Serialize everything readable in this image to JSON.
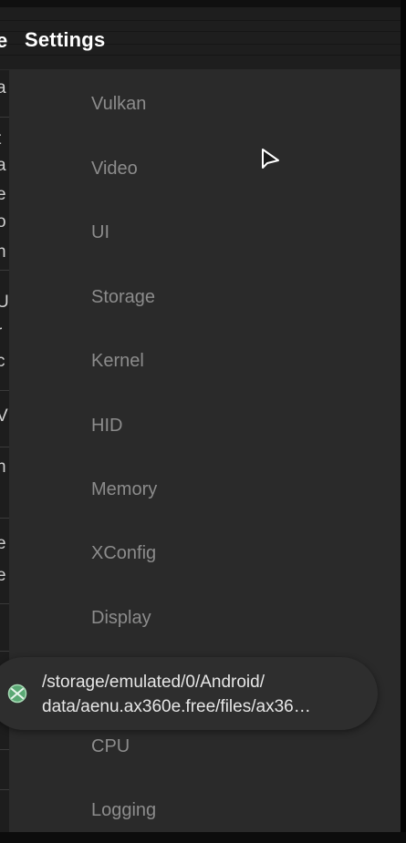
{
  "app_bar": {
    "title": "Settings",
    "edge_fragment": "e"
  },
  "background_page": {
    "edge_fragments": [
      "a",
      "t",
      "a",
      "e",
      "o",
      "n",
      "U",
      "r",
      "c",
      "V",
      "n",
      "e",
      "e"
    ]
  },
  "drawer": {
    "items": [
      {
        "label": "Vulkan"
      },
      {
        "label": "Video"
      },
      {
        "label": "UI"
      },
      {
        "label": "Storage"
      },
      {
        "label": "Kernel"
      },
      {
        "label": "HID"
      },
      {
        "label": "Memory"
      },
      {
        "label": "XConfig"
      },
      {
        "label": "Display"
      },
      {
        "label": "CPU"
      },
      {
        "label": "Logging"
      }
    ]
  },
  "toast": {
    "icon": "xbox-logo-icon",
    "line1": "/storage/emulated/0/Android/",
    "line2": "data/aenu.ax360e.free/files/ax36…"
  },
  "colors": {
    "background": "#232323",
    "drawer": "#2a2a2a",
    "menu_text": "#8c8c8c",
    "title_text": "#ffffff",
    "toast_bg": "#2e2e2e",
    "icon_green": "#6fbf8a"
  }
}
